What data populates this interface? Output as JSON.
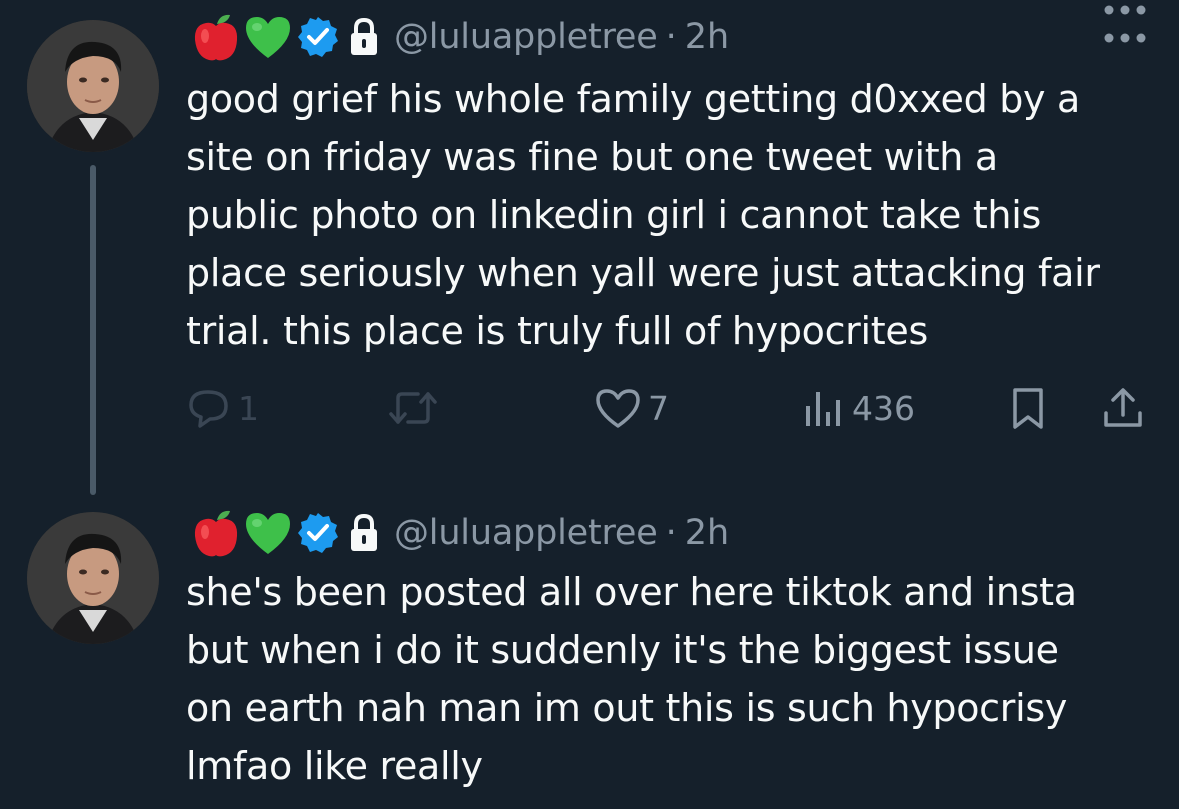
{
  "tweets": [
    {
      "handle": "@luluappletree",
      "separator": "·",
      "time": "2h",
      "text_lines": [
        "good grief his whole family getting d0xxed by a",
        "site on friday was fine but one tweet with a",
        "public photo on linkedin girl i cannot take this",
        "place seriously when yall were just attacking fair",
        "trial. this place is truly full of hypocrites"
      ],
      "replies": "1",
      "likes": "7",
      "views": "436"
    },
    {
      "handle": "@luluappletree",
      "separator": "·",
      "time": "2h",
      "text_lines": [
        "she's been posted all over here tiktok and insta",
        "but when i do it suddenly it's the biggest issue",
        "on earth nah man im out this is such hypocrisy",
        "lmfao like really"
      ]
    }
  ],
  "icons": {
    "name_emojis": [
      "red-apple-icon",
      "green-heart-icon"
    ],
    "verified": "verified-badge-icon",
    "lock": "lock-icon",
    "more": "more-options-icon",
    "actions": [
      "reply-icon",
      "retweet-icon",
      "like-icon",
      "views-icon",
      "bookmark-icon",
      "share-icon"
    ]
  },
  "colors": {
    "background": "#15202b",
    "text": "#f7f9f9",
    "muted": "#8b98a5",
    "verified": "#1d9bf0",
    "apple": "#e0212e",
    "heart": "#3ec04a"
  }
}
